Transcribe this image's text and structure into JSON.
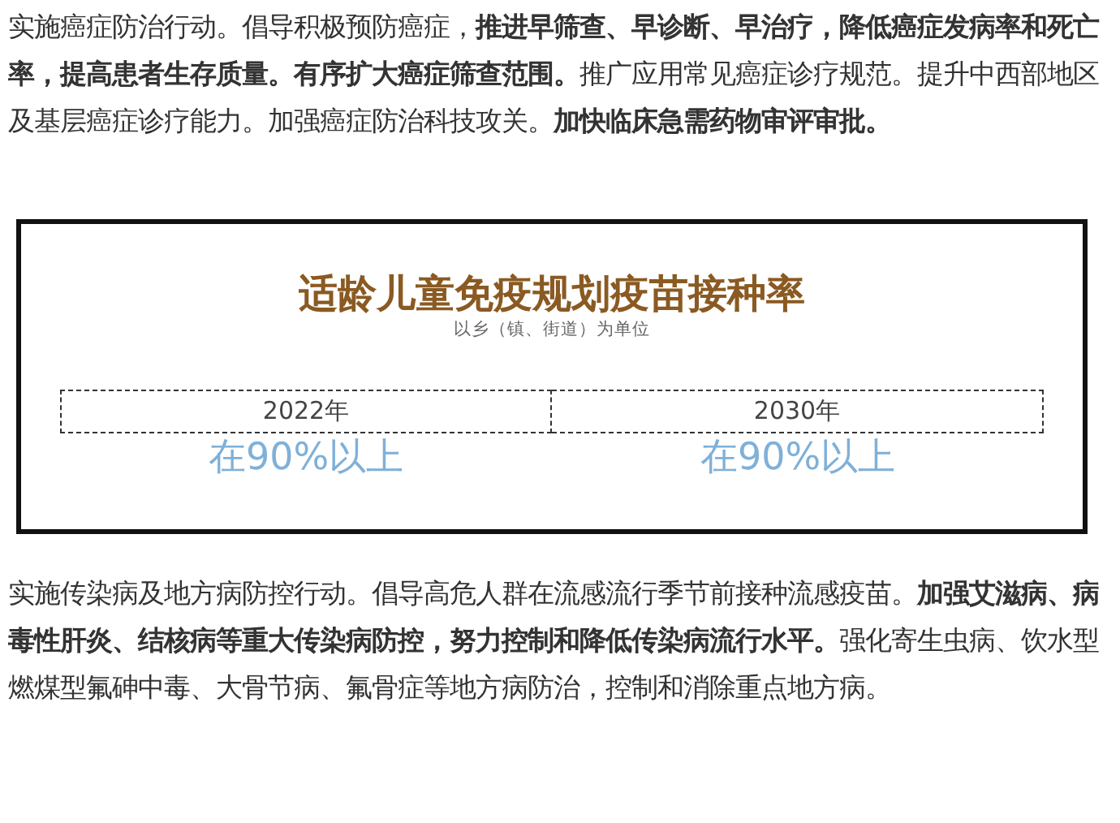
{
  "paragraphs": [
    "实施癌症防治行动。倡导积极预防癌症，**推进早筛查、早诊断、早治疗，降低癌症发病率和死亡率，提高患者生存质量。有序扩大癌症筛查范围。**推广应用常见癌症诊疗规范。提升中西部地区及基层癌症诊疗能力。加强癌症防治科技攻关。**加快临床急需药物审评审批。**",
    "实施传染病及地方病防控行动。倡导高危人群在流感流行季节前接种流感疫苗。**加强艾滋病、病毒性肝炎、结核病等重大传染病防控，努力控制和降低传染病流行水平。**强化寄生虫病、饮水型燃煤型氟砷中毒、大骨节病、氟骨症等地方病防治，控制和消除重点地方病。"
  ],
  "infobox": {
    "title": "适龄儿童免疫规划疫苗接种率",
    "subtitle": "以乡（镇、街道）为单位",
    "columns": [
      {
        "year": "2022年",
        "value": "在90%以上"
      },
      {
        "year": "2030年",
        "value": "在90%以上"
      }
    ]
  }
}
